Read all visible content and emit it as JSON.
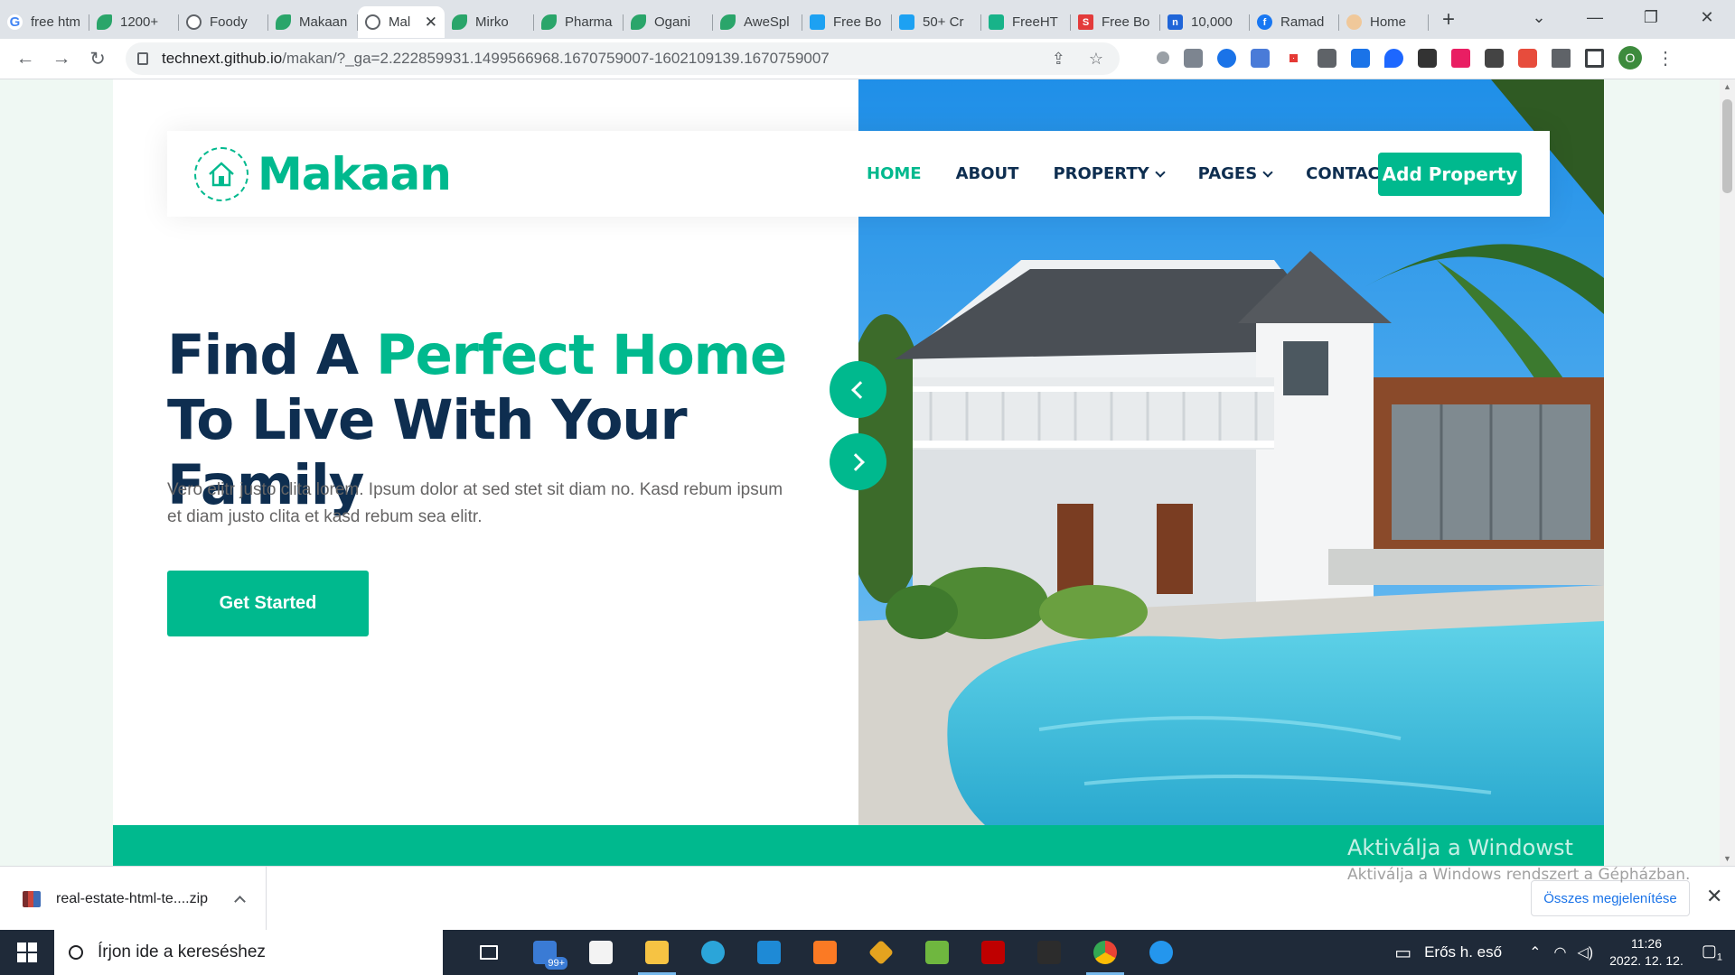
{
  "browser": {
    "tabs": [
      {
        "title": "free htm",
        "icon": "google-icon"
      },
      {
        "title": "1200+",
        "icon": "leaf-icon"
      },
      {
        "title": "Foody",
        "icon": "globe-icon"
      },
      {
        "title": "Makaan",
        "icon": "leaf-icon"
      },
      {
        "title": "Mal",
        "icon": "globe-icon",
        "active": true
      },
      {
        "title": "Mirko",
        "icon": "leaf-icon"
      },
      {
        "title": "Pharma",
        "icon": "leaf-icon"
      },
      {
        "title": "Ogani",
        "icon": "leaf-icon"
      },
      {
        "title": "AweSpl",
        "icon": "leaf-icon"
      },
      {
        "title": "Free Bo",
        "icon": "blue-icon"
      },
      {
        "title": "50+ Cr",
        "icon": "y-icon"
      },
      {
        "title": "FreeHT",
        "icon": "green-flag-icon"
      },
      {
        "title": "Free Bo",
        "icon": "s-icon"
      },
      {
        "title": "10,000",
        "icon": "n-icon"
      },
      {
        "title": "Ramad",
        "icon": "facebook-icon"
      },
      {
        "title": "Home",
        "icon": "home-icon"
      }
    ],
    "url_host": "technext.github.io",
    "url_path": "/makan/?_ga=2.222859931.1499566968.1670759007-1602109139.1670759007",
    "profile_initial": "O"
  },
  "site": {
    "brand": "Makaan",
    "nav": {
      "home": "HOME",
      "about": "ABOUT",
      "property": "PROPERTY",
      "pages": "PAGES",
      "contact": "CONTACT",
      "add_property": "Add Property"
    },
    "hero": {
      "title_part1": "Find A ",
      "title_highlight": "Perfect Home",
      "title_part2": " To Live With Your Family",
      "text": "Vero elitr justo clita lorem. Ipsum dolor at sed stet sit diam no. Kasd rebum ipsum et diam justo clita et kasd rebum sea elitr.",
      "cta": "Get Started"
    },
    "accent_color": "#00b98e",
    "dark_color": "#0e2e50"
  },
  "watermark": {
    "line1": "Aktiválja a Windowst",
    "line2": "Aktiválja a Windows rendszert a Gépházban."
  },
  "downloads": {
    "file": "real-estate-html-te....zip",
    "show_all": "Összes megjelenítése"
  },
  "taskbar": {
    "search_placeholder": "Írjon ide a kereséshez",
    "mail_badge": "99+",
    "weather": "Erős h. eső",
    "time": "11:26",
    "date": "2022. 12. 12.",
    "notification_count": "1"
  }
}
